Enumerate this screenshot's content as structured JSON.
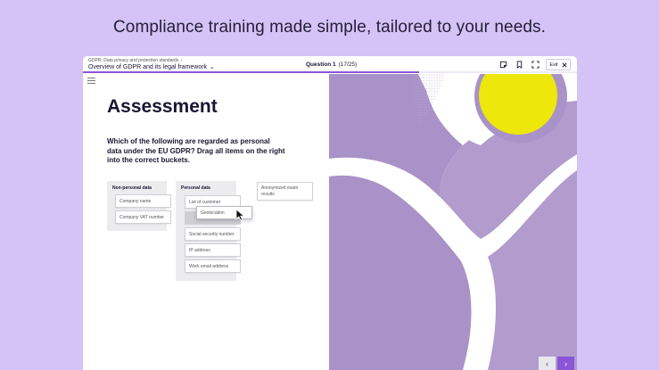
{
  "tagline": "Compliance training made simple, tailored to your needs.",
  "topbar": {
    "breadcrumb": "GDPR: Data privacy and protection standards",
    "module_title": "Overview of GDPR and its legal framework",
    "question_label": "Question 1",
    "question_count": "(17/25)",
    "progress_percent": 68,
    "exit_label": "Exit"
  },
  "content": {
    "heading": "Assessment",
    "question": "Which of the following are regarded as personal data under the EU GDPR? Drag all items on the right into the correct buckets."
  },
  "buckets": {
    "non_personal": {
      "title": "Non-personal data",
      "items": [
        "Company name",
        "Company VAT number"
      ]
    },
    "personal": {
      "title": "Personal data",
      "items": [
        "List of customer",
        "Social security number",
        "IP address",
        "Work email address"
      ]
    }
  },
  "dragging_item": "Geolocation",
  "unsorted_item": "Anonymized exam results",
  "colors": {
    "background": "#d5c2f6",
    "accent": "#8a55d6",
    "art_purple": "#a992c7",
    "art_yellow": "#ede70c"
  },
  "icons": {
    "hamburger": "menu-icon",
    "note": "note-icon",
    "bookmark": "bookmark-icon",
    "fullscreen": "fullscreen-icon",
    "close": "close-icon",
    "prev": "chevron-left-icon",
    "next": "chevron-right-icon"
  }
}
